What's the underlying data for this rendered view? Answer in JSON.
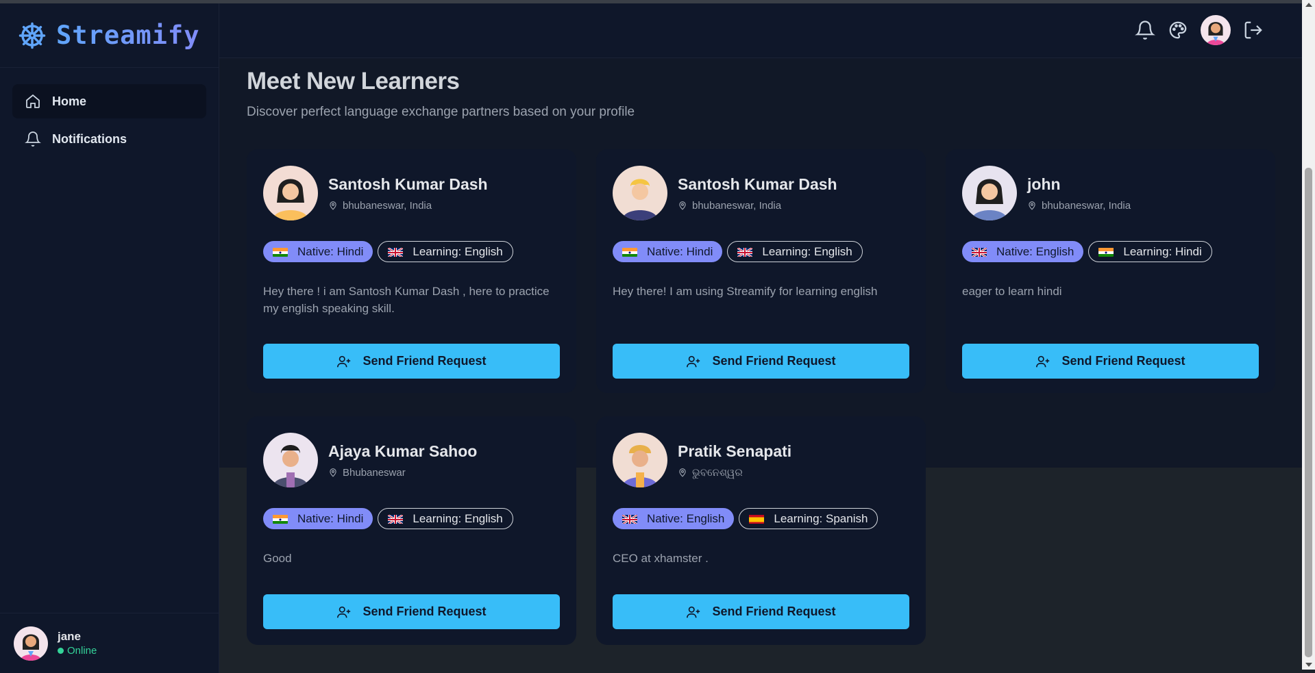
{
  "brand": {
    "name": "Streamify"
  },
  "nav": [
    {
      "label": "Home",
      "icon": "home-icon",
      "active": true
    },
    {
      "label": "Notifications",
      "icon": "bell-icon",
      "active": false
    }
  ],
  "current_user": {
    "name": "jane",
    "status": "Online"
  },
  "header": {
    "icons": [
      "bell-icon",
      "palette-icon",
      "avatar",
      "logout-icon"
    ]
  },
  "page": {
    "title": "Meet New Learners",
    "subtitle": "Discover perfect language exchange partners based on your profile"
  },
  "learners": [
    {
      "name": "Santosh Kumar Dash",
      "location": "bhubaneswar, India",
      "native": "Native: Hindi",
      "native_flag": "india",
      "learning": "Learning: English",
      "learning_flag": "uk",
      "bio": "Hey there ! i am Santosh Kumar Dash , here to practice my english speaking skill.",
      "button": "Send Friend Request"
    },
    {
      "name": "Santosh Kumar Dash",
      "location": "bhubaneswar, India",
      "native": "Native: Hindi",
      "native_flag": "india",
      "learning": "Learning: English",
      "learning_flag": "uk",
      "bio": "Hey there! I am using Streamify for learning english",
      "button": "Send Friend Request"
    },
    {
      "name": "john",
      "location": "bhubaneswar, India",
      "native": "Native: English",
      "native_flag": "uk",
      "learning": "Learning: Hindi",
      "learning_flag": "india",
      "bio": "eager to learn hindi",
      "button": "Send Friend Request"
    },
    {
      "name": "Ajaya Kumar Sahoo",
      "location": "Bhubaneswar",
      "native": "Native: Hindi",
      "native_flag": "india",
      "learning": "Learning: English",
      "learning_flag": "uk",
      "bio": "Good",
      "button": "Send Friend Request"
    },
    {
      "name": "Pratik Senapati",
      "location": "ଭୁବନେଶ୍ୱର",
      "native": "Native: English",
      "native_flag": "uk",
      "learning": "Learning: Spanish",
      "learning_flag": "spain",
      "bio": "CEO at xhamster .",
      "button": "Send Friend Request"
    }
  ],
  "colors": {
    "accent": "#38bdf8",
    "native_badge": "#818cf8",
    "online": "#34d399",
    "bg": "#0f172a"
  }
}
